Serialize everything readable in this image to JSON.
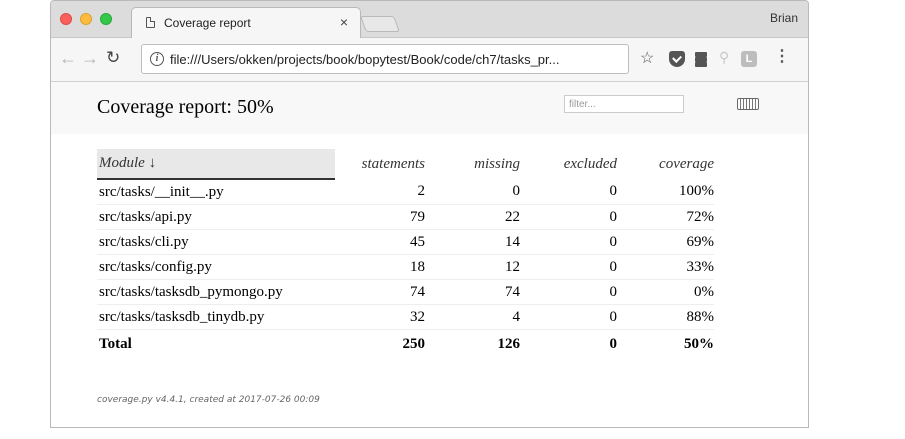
{
  "browser": {
    "tab_title": "Coverage report",
    "tab_close": "×",
    "profile_name": "Brian",
    "url": "file:///Users/okken/projects/book/bopytest/Book/code/ch7/tasks_pr...",
    "extension_lastpass_label": "L"
  },
  "report": {
    "title": "Coverage report: 50%",
    "filter_placeholder": "filter...",
    "columns": [
      "Module ↓",
      "statements",
      "missing",
      "excluded",
      "coverage"
    ],
    "rows": [
      {
        "module": "src/tasks/__init__.py",
        "statements": "2",
        "missing": "0",
        "excluded": "0",
        "coverage": "100%"
      },
      {
        "module": "src/tasks/api.py",
        "statements": "79",
        "missing": "22",
        "excluded": "0",
        "coverage": "72%"
      },
      {
        "module": "src/tasks/cli.py",
        "statements": "45",
        "missing": "14",
        "excluded": "0",
        "coverage": "69%"
      },
      {
        "module": "src/tasks/config.py",
        "statements": "18",
        "missing": "12",
        "excluded": "0",
        "coverage": "33%"
      },
      {
        "module": "src/tasks/tasksdb_pymongo.py",
        "statements": "74",
        "missing": "74",
        "excluded": "0",
        "coverage": "0%"
      },
      {
        "module": "src/tasks/tasksdb_tinydb.py",
        "statements": "32",
        "missing": "4",
        "excluded": "0",
        "coverage": "88%"
      }
    ],
    "total": {
      "label": "Total",
      "statements": "250",
      "missing": "126",
      "excluded": "0",
      "coverage": "50%"
    },
    "footer": "coverage.py v4.4.1, created at 2017-07-26 00:09"
  },
  "icons": {
    "doc": "document-icon",
    "info": "info-icon",
    "star": "star-icon",
    "keyboard": "keyboard-icon"
  }
}
